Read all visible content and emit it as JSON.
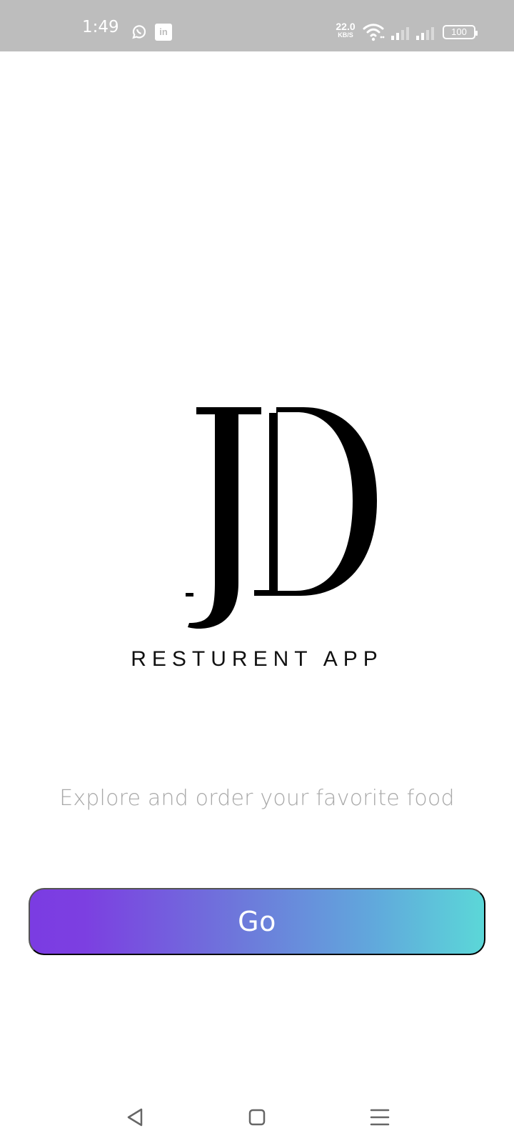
{
  "status_bar": {
    "time": "1:49",
    "network_speed_value": "22.0",
    "network_speed_unit": "KB/S",
    "battery": "100",
    "icons": [
      "whatsapp-icon",
      "linkedin-icon",
      "wifi-icon",
      "signal-icon",
      "signal-icon",
      "battery-icon"
    ]
  },
  "app": {
    "brand_text": "RESTURENT APP",
    "subtitle": "Explore and order your favorite food",
    "go_button_label": "Go",
    "brand_colors": {
      "button_start": "#7b3ce2",
      "button_middle": "#6e76db",
      "button_end": "#5bd7d8",
      "subtitle": "#a8a8a8",
      "text_dark": "#111111"
    }
  },
  "navigation": {
    "icons": [
      "back-icon",
      "home-icon",
      "menu-icon"
    ]
  }
}
